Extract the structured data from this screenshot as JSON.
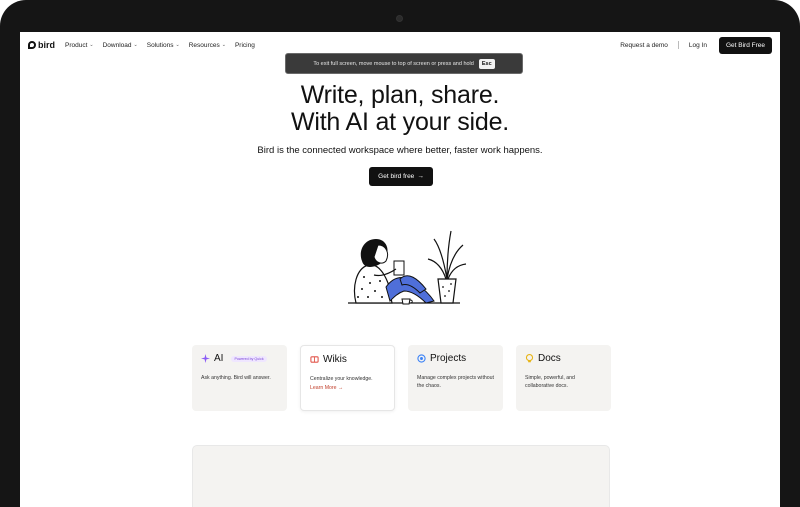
{
  "nav": {
    "brand": "bird",
    "items": [
      {
        "label": "Product",
        "has_dropdown": true
      },
      {
        "label": "Download",
        "has_dropdown": true
      },
      {
        "label": "Solutions",
        "has_dropdown": true
      },
      {
        "label": "Resources",
        "has_dropdown": true
      },
      {
        "label": "Pricing",
        "has_dropdown": false
      }
    ],
    "request_demo": "Request a demo",
    "login": "Log In",
    "cta": "Get Bird Free"
  },
  "toast": {
    "message": "To exit full screen, move mouse to top of screen or press and hold",
    "key": "Esc"
  },
  "hero": {
    "title_line1": "Write, plan, share.",
    "title_line2": "With AI at your side.",
    "subtitle": "Bird is the connected workspace where better, faster work happens.",
    "cta": "Get bird free",
    "cta_arrow": "→"
  },
  "cards": [
    {
      "title": "AI",
      "badge": "Powered by Quick",
      "desc": "Ask anything. Bird will answer.",
      "icon": "sparkle-icon",
      "color": "#8b5cf6"
    },
    {
      "title": "Wikis",
      "desc": "Centralize your knowledge.",
      "link": "Learn More →",
      "icon": "wiki-book-icon",
      "color": "#e2574c"
    },
    {
      "title": "Projects",
      "desc": "Manage complex projects without the chaos.",
      "icon": "target-icon",
      "color": "#3b82f6"
    },
    {
      "title": "Docs",
      "desc": "Simple, powerful, and collaborative docs.",
      "icon": "docs-bulb-icon",
      "color": "#e7b416"
    }
  ],
  "colors": {
    "accent_link": "#c2412d",
    "dark": "#111111",
    "legs_blue": "#4f6fd9"
  }
}
